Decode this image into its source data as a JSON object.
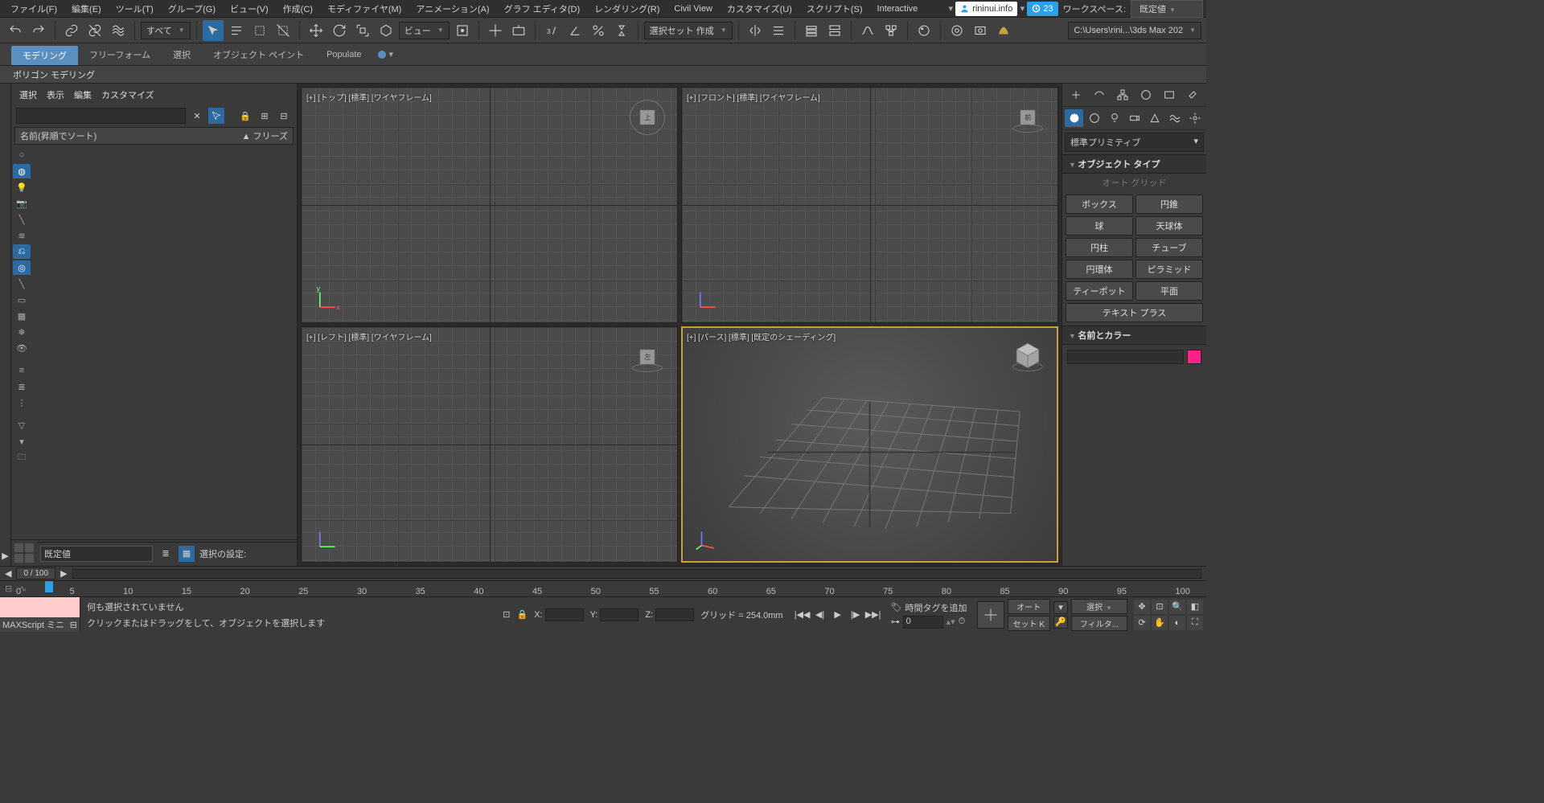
{
  "menu": {
    "items": [
      "ファイル(F)",
      "編集(E)",
      "ツール(T)",
      "グループ(G)",
      "ビュー(V)",
      "作成(C)",
      "モディファイヤ(M)",
      "アニメーション(A)",
      "グラフ エディタ(D)",
      "レンダリング(R)",
      "Civil View",
      "カスタマイズ(U)",
      "スクリプト(S)",
      "Interactive"
    ],
    "login": "rininui.info",
    "notif": "23",
    "workspace_label": "ワークスペース:",
    "workspace_value": "既定値"
  },
  "toolbar": {
    "all": "すべて",
    "view": "ビュー",
    "selset": "選択セット 作成",
    "path": "C:\\Users\\rini...\\3ds Max 202"
  },
  "ribbon": {
    "tabs": [
      "モデリング",
      "フリーフォーム",
      "選択",
      "オブジェクト ペイント",
      "Populate"
    ],
    "subtab": "ポリゴン モデリング"
  },
  "scene": {
    "hdr": [
      "選択",
      "表示",
      "編集",
      "カスタマイズ"
    ],
    "col_name": "名前(昇順でソート)",
    "col_freeze": "▲ フリーズ",
    "footer_default": "既定値",
    "footer_label": "選択の設定:"
  },
  "viewports": {
    "top": "[+]  [トップ]  [標準]  [ワイヤフレーム]",
    "front": "[+]  [フロント]  [標準]  [ワイヤフレーム]",
    "left": "[+]  [レフト]  [標準]  [ワイヤフレーム]",
    "persp": "[+]  [パース]  [標準]  [既定のシェーディング]",
    "cube_top": "上",
    "cube_front": "前",
    "cube_left": "左"
  },
  "cmd": {
    "dropdown": "標準プリミティブ",
    "rollout_obj": "オブジェクト タイプ",
    "autogrid": "オート グリッド",
    "buttons": [
      "ボックス",
      "円錐",
      "球",
      "天球体",
      "円柱",
      "チューブ",
      "円環体",
      "ピラミッド",
      "ティーポット",
      "平面",
      "テキスト プラス"
    ],
    "rollout_name": "名前とカラー"
  },
  "time": {
    "frame": "0 / 100",
    "ticks": [
      "0",
      "5",
      "10",
      "15",
      "20",
      "25",
      "30",
      "35",
      "40",
      "45",
      "50",
      "55",
      "60",
      "65",
      "70",
      "75",
      "80",
      "85",
      "90",
      "95",
      "100"
    ]
  },
  "status": {
    "script": "MAXScript ミニ",
    "msg1": "何も選択されていません",
    "msg2": "クリックまたはドラッグをして、オブジェクトを選択します",
    "x": "X:",
    "y": "Y:",
    "z": "Z:",
    "grid": "グリッド = 254.0mm",
    "addtag": "時間タグを追加",
    "spin": "0",
    "auto": "オート",
    "setk": "セット K",
    "sel": "選択",
    "filter": "フィルタ..."
  }
}
